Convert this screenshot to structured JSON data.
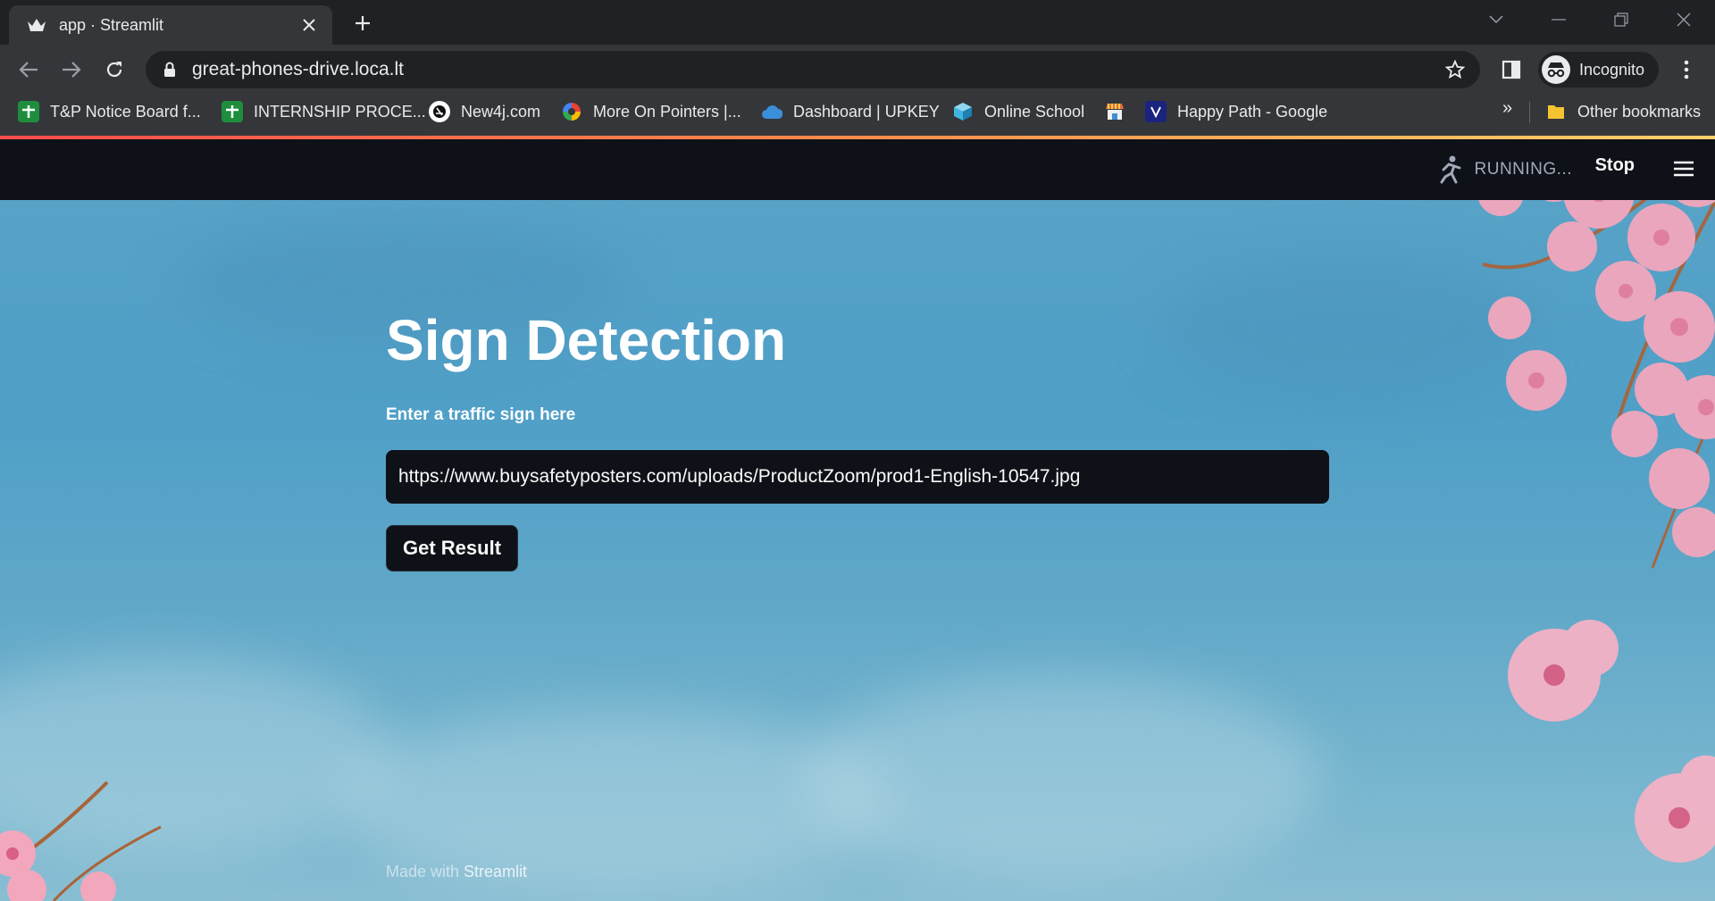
{
  "browser": {
    "tab": {
      "title": "app · Streamlit"
    },
    "url": "great-phones-drive.loca.lt",
    "profile_label": "Incognito",
    "bookmarks": [
      {
        "label": "T&P Notice Board f...",
        "icon": "green-plus-icon",
        "color": "#1e8e3e"
      },
      {
        "label": "INTERNSHIP PROCE...",
        "icon": "green-plus-icon",
        "color": "#1e8e3e"
      },
      {
        "label": "New4j.com",
        "icon": "new4j-icon",
        "color": "#ffffff"
      },
      {
        "label": "More On Pointers |...",
        "icon": "colorful-swirl-icon",
        "color": "#e94235"
      },
      {
        "label": "Dashboard | UPKEY",
        "icon": "blue-cloud-icon",
        "color": "#3b8fd9"
      },
      {
        "label": "Online School",
        "icon": "cube-icon",
        "color": "#3fb6e0"
      },
      {
        "label": "",
        "icon": "store-icon",
        "color": "#e66b3d"
      },
      {
        "label": "Happy Path - Google",
        "icon": "v-logo-icon",
        "color": "#1a237e"
      }
    ],
    "more_bookmarks": "»",
    "other_bookmarks": "Other bookmarks"
  },
  "app": {
    "status": "RUNNING...",
    "stop_label": "Stop",
    "title": "Sign Detection",
    "input_label": "Enter a traffic sign here",
    "input_value": "https://www.buysafetyposters.com/uploads/ProductZoom/prod1-English-10547.jpg",
    "button_label": "Get Result",
    "footer_prefix": "Made with ",
    "footer_brand": "Streamlit"
  },
  "colors": {
    "header_bg": "#0e1117",
    "sky_blue": "#5aa3c7",
    "blossom_pink": "#f2a7bd"
  }
}
